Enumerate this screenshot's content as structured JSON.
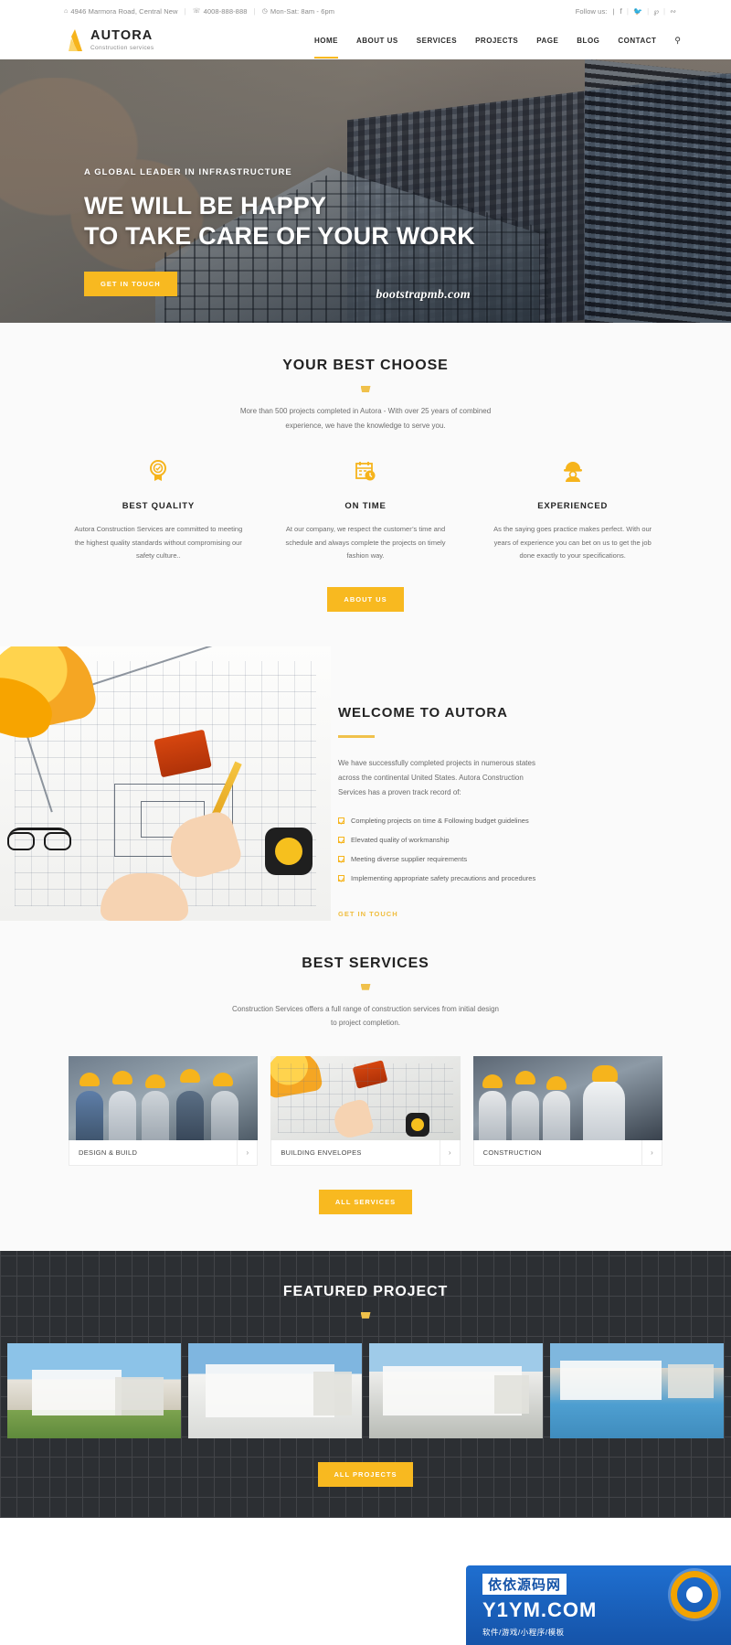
{
  "topbar": {
    "address": "4946 Marmora Road, Central New",
    "phone": "4008-888-888",
    "hours": "Mon-Sat: 8am - 6pm",
    "follow_label": "Follow us:",
    "social": [
      "f",
      "ᵥ",
      "ᵖ",
      "ᴿ"
    ],
    "icons": {
      "address": "home-icon",
      "phone": "phone-icon",
      "hours": "clock-icon"
    }
  },
  "header": {
    "brand": "AUTORA",
    "tagline": "Construction services",
    "nav": [
      {
        "label": "HOME",
        "active": true
      },
      {
        "label": "ABOUT US",
        "active": false
      },
      {
        "label": "SERVICES",
        "active": false
      },
      {
        "label": "PROJECTS",
        "active": false
      },
      {
        "label": "PAGE",
        "active": false
      },
      {
        "label": "BLOG",
        "active": false
      },
      {
        "label": "CONTACT",
        "active": false
      }
    ],
    "search_icon": "search-icon"
  },
  "hero": {
    "subtitle": "A GLOBAL LEADER IN INFRASTRUCTURE",
    "title_line1": "WE WILL BE HAPPY",
    "title_line2": "TO TAKE CARE OF YOUR WORK",
    "button": "GET IN TOUCH",
    "watermark": "bootstrapmb.com"
  },
  "best_choose": {
    "title": "YOUR BEST CHOOSE",
    "description": "More than 500 projects completed in Autora - With over 25 years of combined experience, we have the knowledge to serve you.",
    "features": [
      {
        "icon": "award-medal-icon",
        "glyph": "☘",
        "title": "BEST QUALITY",
        "text": "Autora Construction Services are committed to meeting the highest quality standards without compromising our safety culture.."
      },
      {
        "icon": "calendar-clock-icon",
        "glyph": "☷",
        "title": "ON TIME",
        "text": "At our company, we respect the customer’s time and schedule and always complete the projects on timely fashion way."
      },
      {
        "icon": "worker-helmet-icon",
        "glyph": "♟",
        "title": "EXPERIENCED",
        "text": "As the saying goes practice makes perfect. With our years of experience you can bet on us to get the job done exactly to your specifications."
      }
    ],
    "button": "ABOUT US"
  },
  "welcome": {
    "title": "WELCOME TO AUTORA",
    "intro": "We have successfully completed projects in numerous states across the continental United States. Autora Construction Services has a proven track record of:",
    "checklist": [
      "Completing projects on time & Following budget guidelines",
      "Elevated quality of workmanship",
      "Meeting diverse supplier requirements",
      "Implementing appropriate safety precautions and procedures"
    ],
    "link": "GET IN TOUCH"
  },
  "services": {
    "title": "BEST SERVICES",
    "description": "Construction Services offers a full range of construction services from initial design to project completion.",
    "cards": [
      {
        "label": "DESIGN & BUILD",
        "arrow": "›"
      },
      {
        "label": "BUILDING ENVELOPES",
        "arrow": "›"
      },
      {
        "label": "CONSTRUCTION",
        "arrow": "›"
      }
    ],
    "button": "ALL SERVICES"
  },
  "featured": {
    "title": "FEATURED PROJECT",
    "projects": [
      "project-1",
      "project-2",
      "project-3",
      "project-4"
    ],
    "button": "ALL PROJECTS"
  },
  "badge": {
    "cn": "依依源码网",
    "url": "Y1YM.COM",
    "sub": "软件/游戏/小程序/模板"
  },
  "colors": {
    "accent": "#f8b920",
    "dark": "#2c2f33",
    "text": "#6d6d6d"
  }
}
